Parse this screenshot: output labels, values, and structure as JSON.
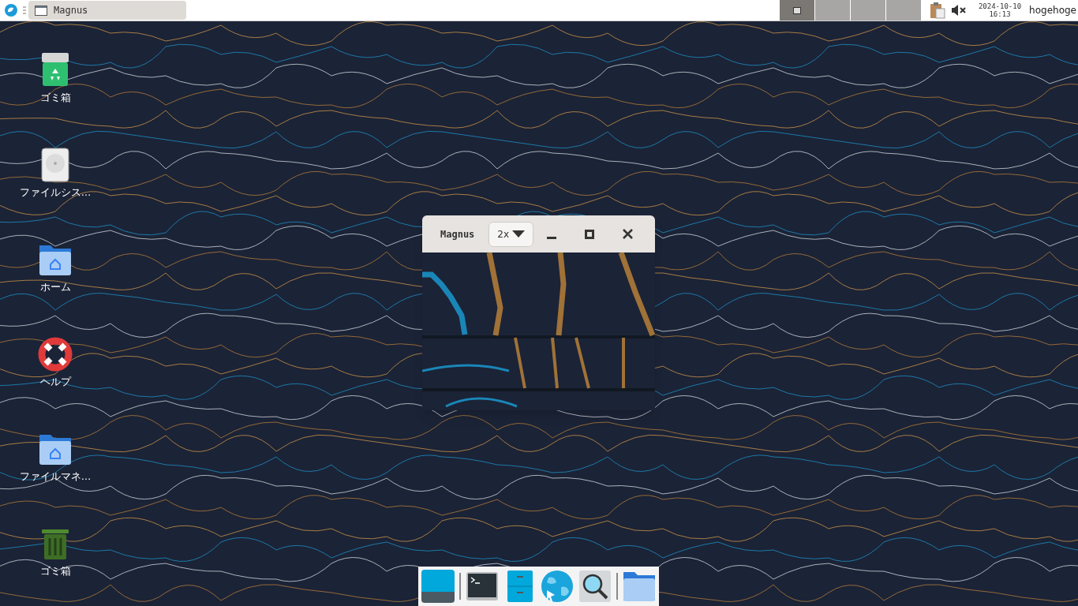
{
  "top_panel": {
    "task_button": {
      "title": "Magnus"
    },
    "workspaces": [
      {
        "selected": true
      },
      {
        "selected": false
      },
      {
        "selected": false
      },
      {
        "selected": false
      }
    ],
    "volume": {
      "muted": true
    },
    "clock": {
      "date": "2024-10-10",
      "time": "16:13"
    },
    "user": "hogehoge"
  },
  "desktop_icons": [
    {
      "kind": "trash-full",
      "label": "ゴミ箱"
    },
    {
      "kind": "drive",
      "label": "ファイルシス…"
    },
    {
      "kind": "home-folder",
      "label": "ホーム"
    },
    {
      "kind": "help",
      "label": "ヘルプ"
    },
    {
      "kind": "home-folder",
      "label": "ファイルマネ…"
    },
    {
      "kind": "trash-empty",
      "label": "ゴミ箱"
    }
  ],
  "magnus_window": {
    "title": "Magnus",
    "zoom": "2x"
  },
  "dock": [
    {
      "kind": "desktop"
    },
    {
      "kind": "separator"
    },
    {
      "kind": "terminal"
    },
    {
      "kind": "cabinet"
    },
    {
      "kind": "browser"
    },
    {
      "kind": "search"
    },
    {
      "kind": "separator"
    },
    {
      "kind": "folder"
    }
  ]
}
